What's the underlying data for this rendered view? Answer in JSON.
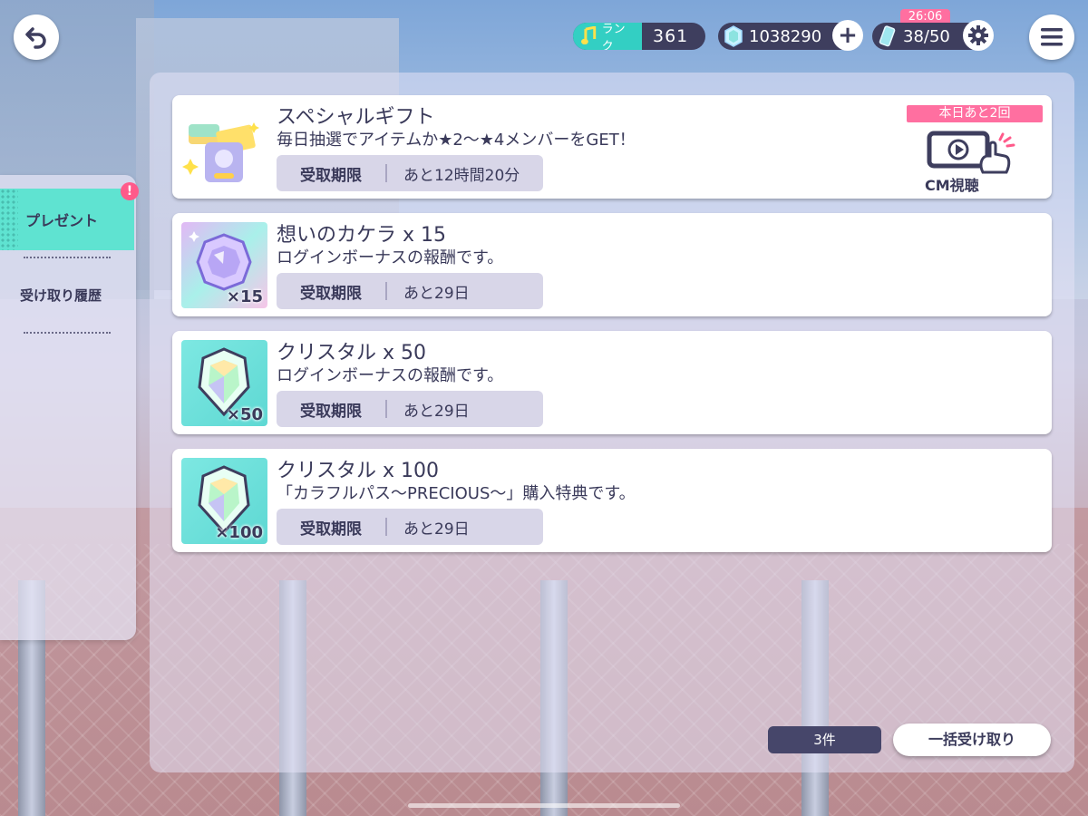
{
  "header": {
    "rank_label": "ランク",
    "rank_value": "361",
    "crystals": "1038290",
    "stamina": "38/50",
    "stamina_timer": "26:06"
  },
  "sidebar": {
    "items": [
      {
        "label": "プレゼント",
        "active": true
      },
      {
        "label": "受け取り履歴",
        "active": false
      }
    ],
    "alert_badge": "!"
  },
  "special_gift": {
    "title": "スペシャルギフト",
    "description": "毎日抽選でアイテムか★2〜★4メンバーをGET！",
    "limit_label": "受取期限",
    "limit_value": "あと12時間20分",
    "quota_badge": "本日あと2回",
    "cm_label": "CM視聴"
  },
  "gifts": [
    {
      "title": "想いのカケラ x 15",
      "description": "ログインボーナスの報酬です。",
      "limit_label": "受取期限",
      "limit_value": "あと29日",
      "qty": "×15",
      "icon": "fragment-gem-icon"
    },
    {
      "title": "クリスタル x 50",
      "description": "ログインボーナスの報酬です。",
      "limit_label": "受取期限",
      "limit_value": "あと29日",
      "qty": "×50",
      "icon": "crystal-icon"
    },
    {
      "title": "クリスタル x 100",
      "description": "「カラフルパス〜PRECIOUS〜」購入特典です。",
      "limit_label": "受取期限",
      "limit_value": "あと29日",
      "qty": "×100",
      "icon": "crystal-icon"
    }
  ],
  "footer": {
    "count": "3件",
    "claim_all_label": "一括受け取り"
  },
  "colors": {
    "accent_teal": "#5fe3d1",
    "pink": "#ff6fa0",
    "navy": "#3e3e5e"
  }
}
